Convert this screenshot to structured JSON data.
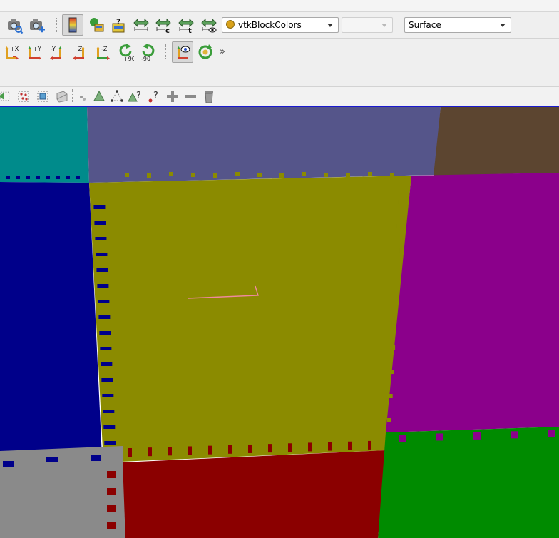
{
  "toolbar_main": {
    "icons": [
      "capture-screenshot-icon",
      "capture-screenshot-plus-icon",
      "toggle-color-legend-icon",
      "edit-color-map-icon",
      "rescale-custom-range-icon",
      "rescale-data-range-icon",
      "rescale-custom-range-c-icon",
      "rescale-temporal-range-icon",
      "rescale-visible-range-icon"
    ],
    "coloring": {
      "selected": "vtkBlockColors"
    },
    "component": {
      "selected": ""
    },
    "representation": {
      "selected": "Surface"
    }
  },
  "toolbar_camera": {
    "buttons": [
      {
        "label": "+X",
        "icon": "view-plus-x-icon"
      },
      {
        "label": "+Y",
        "icon": "view-plus-y-icon"
      },
      {
        "label": "-Y",
        "icon": "view-minus-y-icon"
      },
      {
        "label": "+Z",
        "icon": "view-plus-z-icon"
      },
      {
        "label": "-Z",
        "icon": "view-minus-z-icon"
      },
      {
        "label": "+90",
        "icon": "rotate-plus-90-icon"
      },
      {
        "label": "-90",
        "icon": "rotate-minus-90-icon"
      }
    ],
    "extra_icons": [
      "show-orientation-axes-icon",
      "reset-camera-icon"
    ],
    "overflow": "»"
  },
  "toolbar_selection": {
    "icons": [
      "select-cells-on-icon",
      "select-points-on-icon",
      "select-cells-frustum-icon",
      "select-points-frustum-icon",
      "interactive-select-icon",
      "select-polygon-icon",
      "select-points-polygon-icon",
      "hover-cells-icon",
      "hover-points-icon",
      "grow-selection-icon",
      "shrink-selection-icon",
      "clear-selection-icon"
    ]
  },
  "colors": {
    "teal": "#008b8b",
    "slate": "#55558a",
    "brown": "#5c4530",
    "navy": "#00008a",
    "olive": "#8b8b00",
    "purple": "#8b008b",
    "gray": "#8a8a8a",
    "red": "#8b0000",
    "green": "#008b00",
    "viewport_border": "#1a1ad0"
  }
}
